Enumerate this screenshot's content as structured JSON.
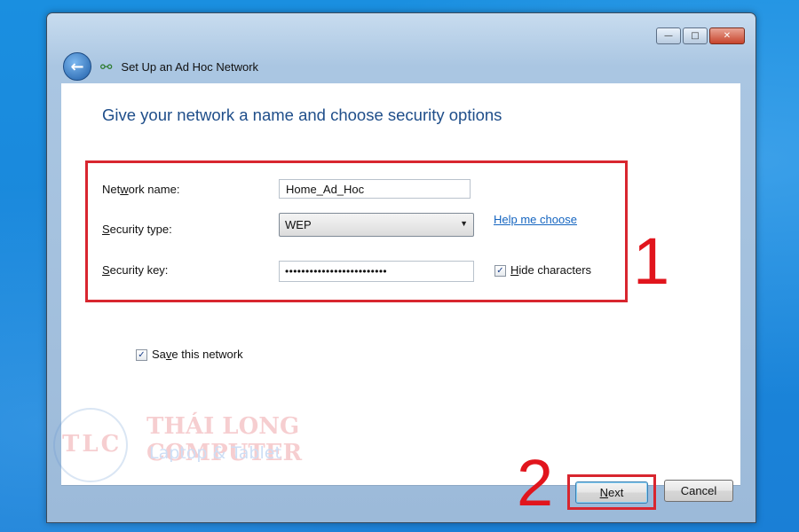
{
  "window": {
    "title": "Set Up an Ad Hoc Network",
    "caption_buttons": {
      "minimize": "—",
      "maximize": "□",
      "close": "✕"
    },
    "back_icon": "back-arrow-icon",
    "network_icon": "network-icon"
  },
  "page": {
    "heading": "Give your network a name and choose security options"
  },
  "form": {
    "network_name": {
      "label_pre": "Net",
      "label_key": "w",
      "label_post": "ork name:",
      "value": "Home_Ad_Hoc"
    },
    "security_type": {
      "label_pre": "",
      "label_key": "S",
      "label_post": "ecurity type:",
      "value": "WEP"
    },
    "security_key": {
      "label_pre": "",
      "label_key": "S",
      "label_post": "ecurity key:",
      "value": "•••••••••••••••••••••••••"
    },
    "help_link": "Help me choose",
    "hide_characters": {
      "checked": true,
      "label_key": "H",
      "label_post": "ide characters"
    },
    "save_network": {
      "checked": true,
      "label_pre": "Sa",
      "label_key": "v",
      "label_post": "e this network"
    }
  },
  "annotations": {
    "marker_1": "1",
    "marker_2": "2",
    "highlight_color": "#d8262f"
  },
  "watermark": {
    "logo": "TLC",
    "name": "THÁI LONG COMPUTER",
    "tagline": "Laptop & Tablet"
  },
  "buttons": {
    "next_key": "N",
    "next_rest": "ext",
    "cancel": "Cancel"
  }
}
